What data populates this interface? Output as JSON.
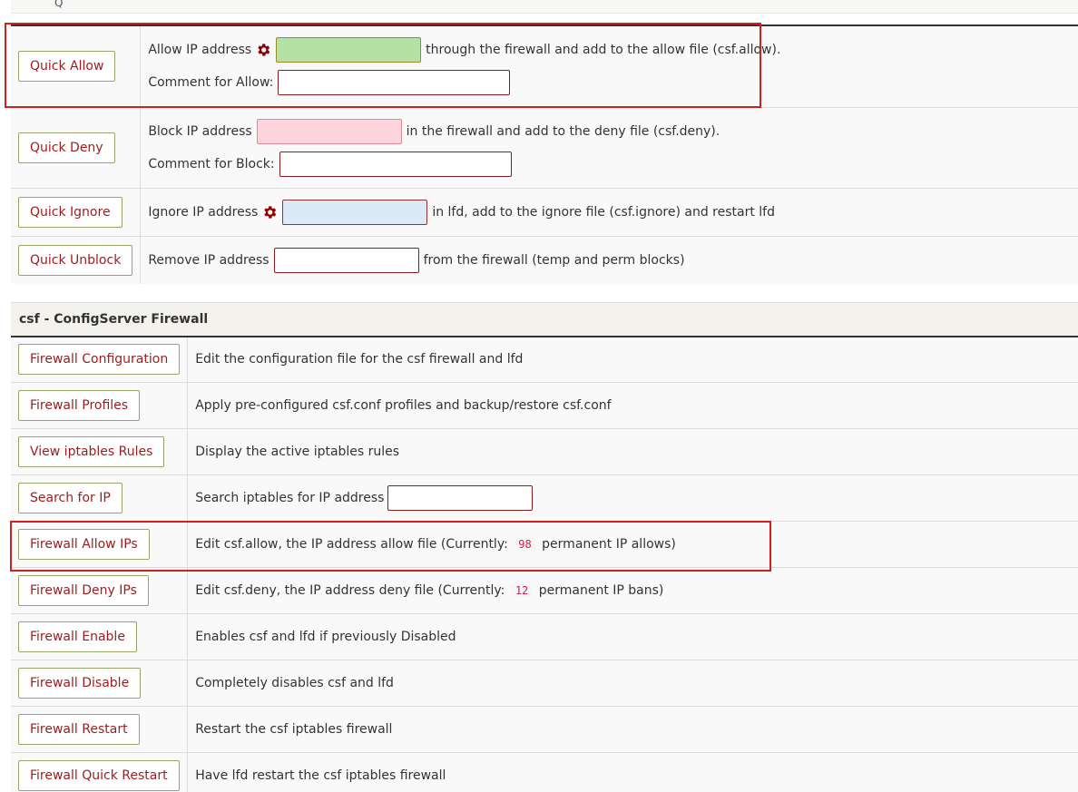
{
  "top_strip": {
    "glyph": "Q"
  },
  "quick_actions": {
    "allow": {
      "button": "Quick Allow",
      "pre": "Allow IP address",
      "post": "through the firewall and add to the allow file (csf.allow).",
      "comment_label": "Comment for Allow:",
      "ip_value": "",
      "comment_value": ""
    },
    "deny": {
      "button": "Quick Deny",
      "pre": "Block IP address",
      "post": "in the firewall and add to the deny file (csf.deny).",
      "comment_label": "Comment for Block:",
      "ip_value": "",
      "comment_value": ""
    },
    "ignore": {
      "button": "Quick Ignore",
      "pre": "Ignore IP address",
      "post": "in lfd, add to the ignore file (csf.ignore) and restart lfd",
      "ip_value": ""
    },
    "unblock": {
      "button": "Quick Unblock",
      "pre": "Remove IP address",
      "post": "from the firewall (temp and perm blocks)",
      "ip_value": ""
    }
  },
  "csf": {
    "title": "csf - ConfigServer Firewall",
    "rows": [
      {
        "button": "Firewall Configuration",
        "desc": "Edit the configuration file for the csf firewall and lfd"
      },
      {
        "button": "Firewall Profiles",
        "desc": "Apply pre-configured csf.conf profiles and backup/restore csf.conf"
      },
      {
        "button": "View iptables Rules",
        "desc": "Display the active iptables rules"
      },
      {
        "button": "Search for IP",
        "desc": "Search iptables for IP address",
        "search_value": ""
      },
      {
        "button": "Firewall Allow IPs",
        "desc_pre": "Edit csf.allow, the IP address allow file (Currently:",
        "count": "98",
        "desc_post": "permanent IP allows)"
      },
      {
        "button": "Firewall Deny IPs",
        "desc_pre": "Edit csf.deny, the IP address deny file (Currently:",
        "count": "12",
        "desc_post": "permanent IP bans)"
      },
      {
        "button": "Firewall Enable",
        "desc": "Enables csf and lfd if previously Disabled"
      },
      {
        "button": "Firewall Disable",
        "desc": "Completely disables csf and lfd"
      },
      {
        "button": "Firewall Restart",
        "desc": "Restart the csf iptables firewall"
      },
      {
        "button": "Firewall Quick Restart",
        "desc": "Have lfd restart the csf iptables firewall"
      }
    ]
  },
  "colors": {
    "button_text": "#9c1c1c",
    "button_border": "#9aa46a",
    "allow_input_bg": "#b4e1a6",
    "deny_input_bg": "#fdd3dc",
    "ignore_input_bg": "#dbeaf6",
    "gear_icon": "#8b0000",
    "highlight_box": "#d21f1f",
    "count_text": "#c7254e"
  },
  "icons": {
    "allow_gear": "gear-icon",
    "ignore_gear": "gear-icon"
  }
}
